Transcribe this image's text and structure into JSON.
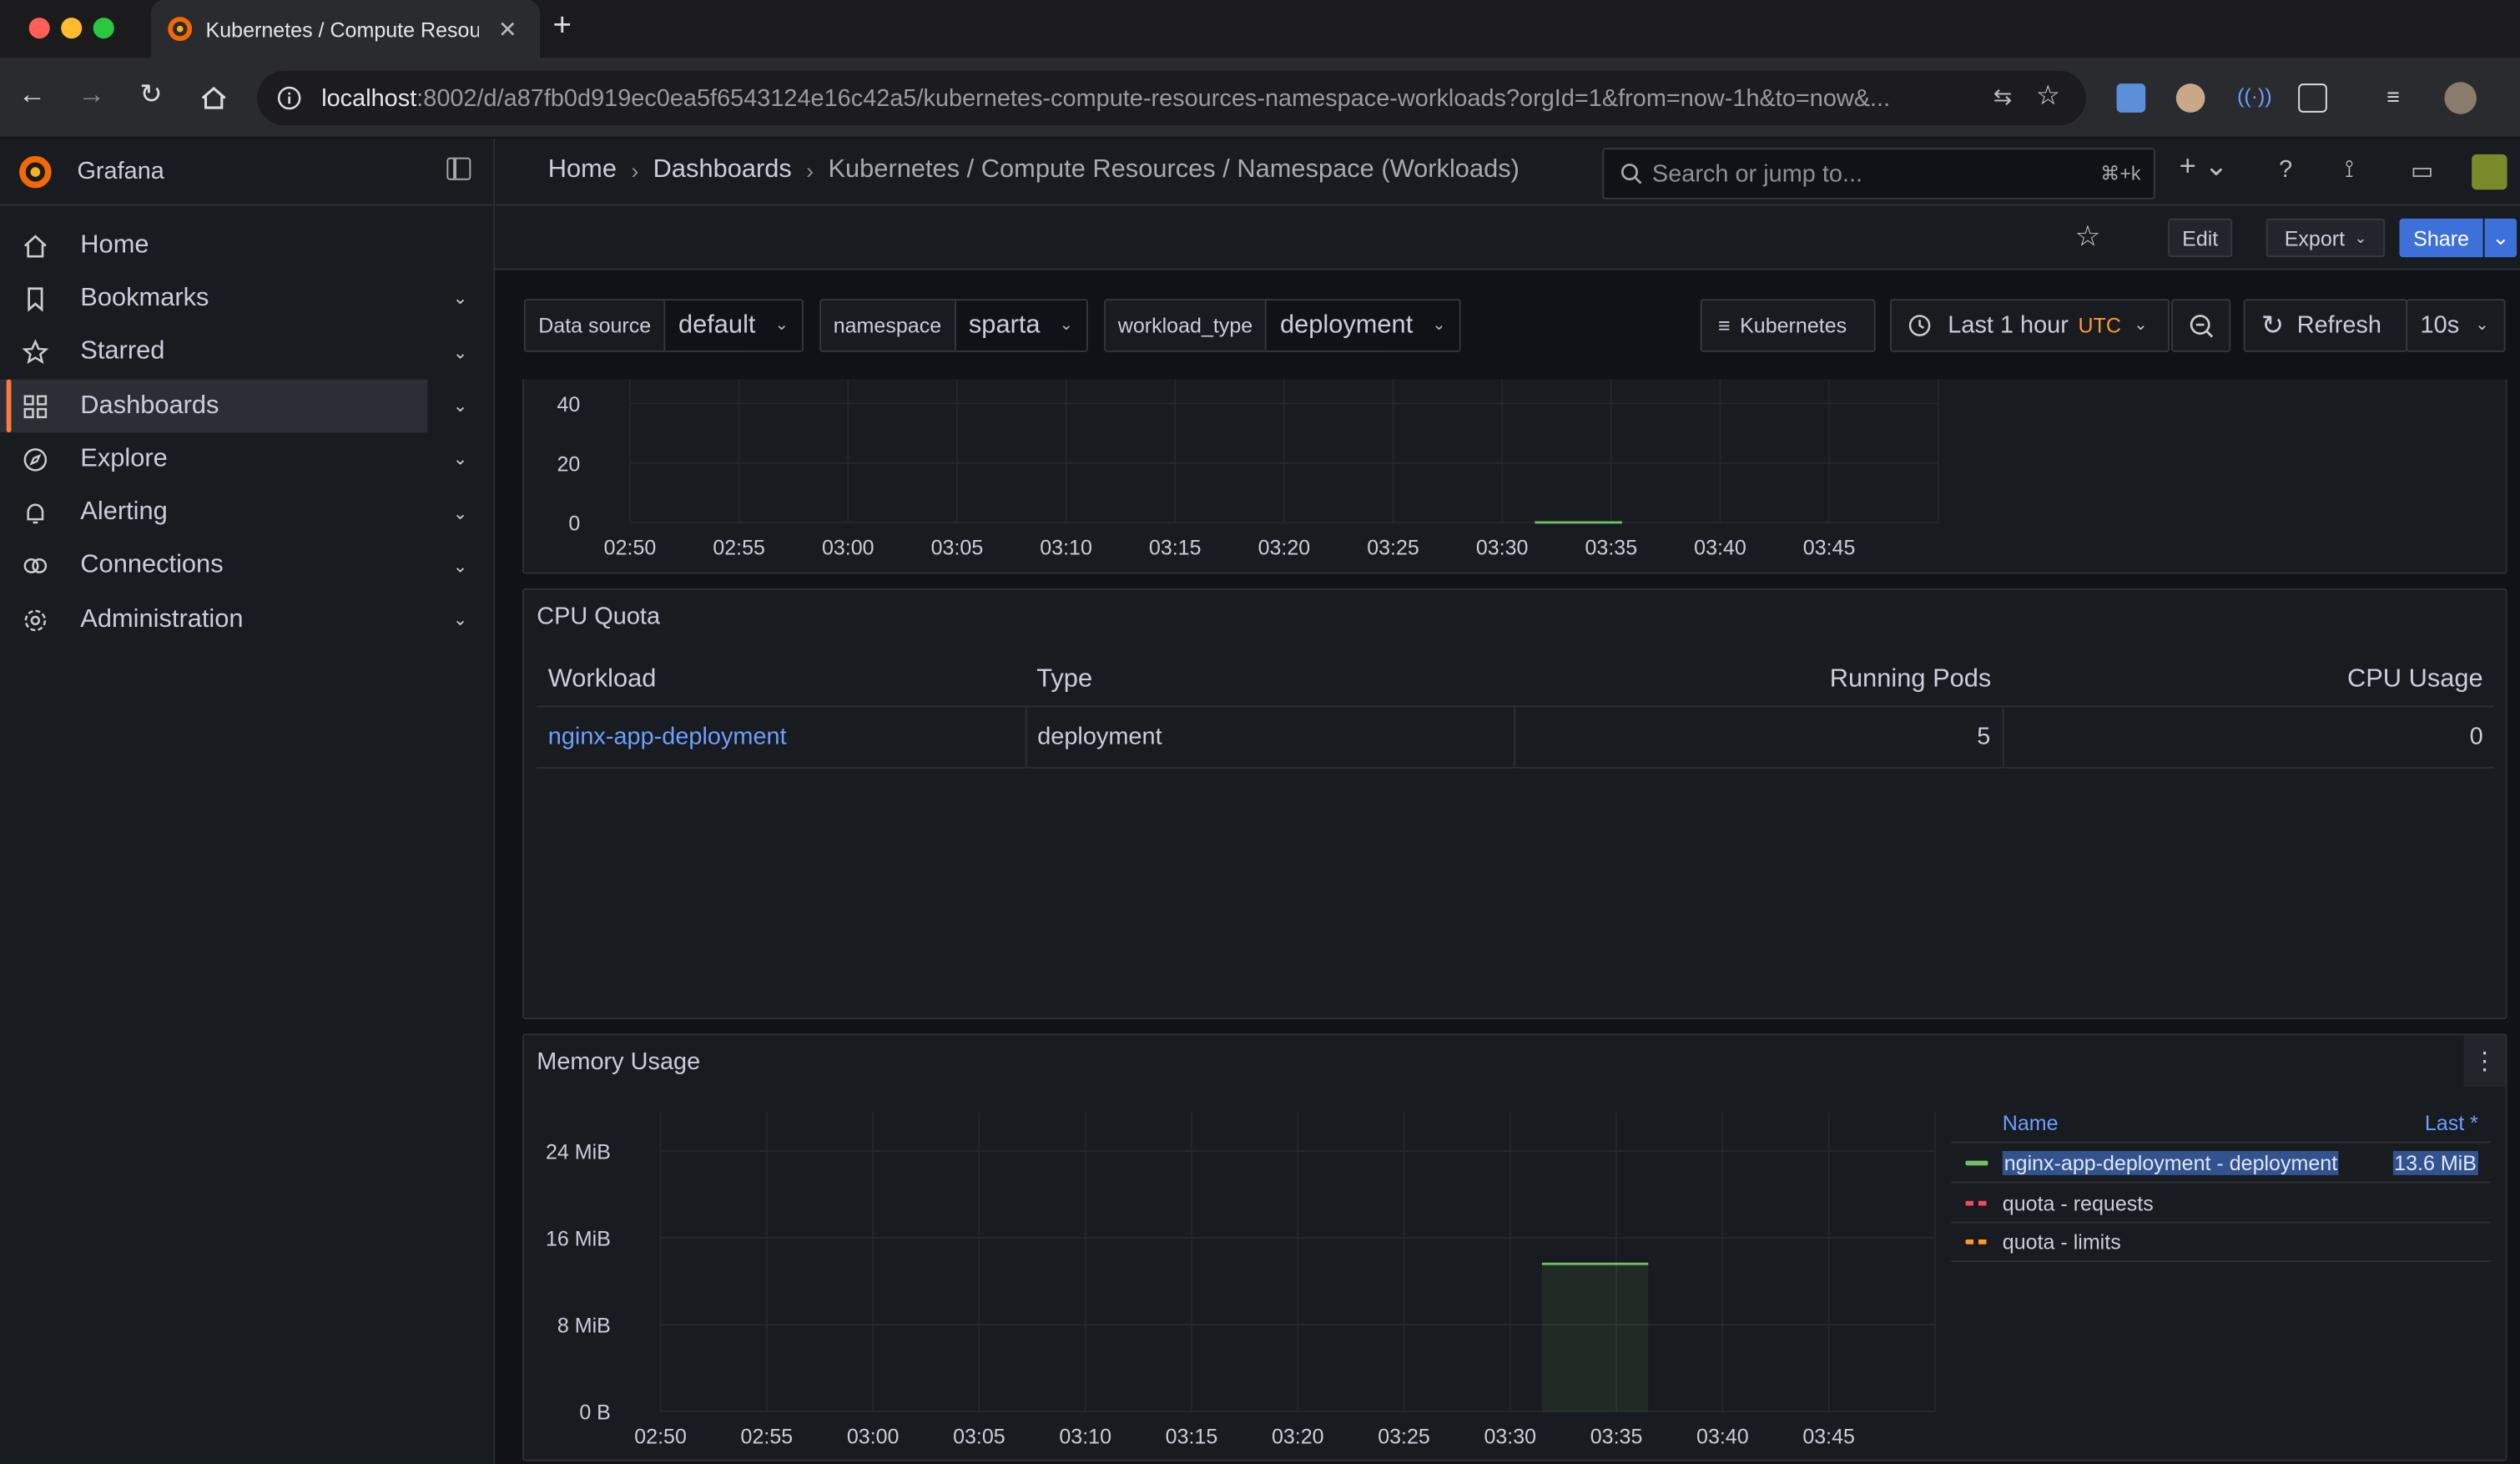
{
  "browser": {
    "tab_title": "Kubernetes / Compute Resou",
    "url_host": "localhost",
    "url_rest": ":8002/d/a87fb0d919ec0ea5f6543124e16c42a5/kubernetes-compute-resources-namespace-workloads?orgId=1&from=now-1h&to=now&...",
    "colors": {
      "close": "#ff5f57",
      "minimize": "#febc2e",
      "zoom": "#28c840"
    }
  },
  "app": {
    "name": "Grafana",
    "accent": "#ff7941",
    "link": "#6e9fff"
  },
  "sidebar": {
    "items": [
      {
        "label": "Home",
        "icon": "home-icon"
      },
      {
        "label": "Bookmarks",
        "icon": "bookmark-icon"
      },
      {
        "label": "Starred",
        "icon": "star-icon"
      },
      {
        "label": "Dashboards",
        "icon": "grid-icon"
      },
      {
        "label": "Explore",
        "icon": "compass-icon"
      },
      {
        "label": "Alerting",
        "icon": "bell-icon"
      },
      {
        "label": "Connections",
        "icon": "connections-icon"
      },
      {
        "label": "Administration",
        "icon": "cog-icon"
      }
    ]
  },
  "header": {
    "breadcrumb": [
      "Home",
      "Dashboards",
      "Kubernetes / Compute Resources / Namespace (Workloads)"
    ],
    "search_placeholder": "Search or jump to...",
    "shortcut": "⌘+k"
  },
  "toolbar": {
    "edit": "Edit",
    "export": "Export",
    "share": "Share"
  },
  "variables": [
    {
      "label": "Data source",
      "value": "default"
    },
    {
      "label": "namespace",
      "value": "sparta"
    },
    {
      "label": "workload_type",
      "value": "deployment"
    }
  ],
  "controls": {
    "dashboards_link": "Kubernetes",
    "time_range": "Last 1 hour",
    "timezone": "UTC",
    "refresh": "Refresh",
    "refresh_interval": "10s"
  },
  "top_panel": {
    "chart_data": {
      "type": "line",
      "x": [
        "02:50",
        "02:55",
        "03:00",
        "03:05",
        "03:10",
        "03:15",
        "03:20",
        "03:25",
        "03:30",
        "03:35",
        "03:40",
        "03:45"
      ],
      "y_ticks": [
        "0",
        "20",
        "40"
      ],
      "series": [
        {
          "color": "#73bf69",
          "points": [
            [
              41.5,
              0
            ],
            [
              45.5,
              0
            ]
          ]
        }
      ]
    }
  },
  "cpu_quota": {
    "title": "CPU Quota",
    "columns": [
      "Workload",
      "Type",
      "Running Pods",
      "CPU Usage"
    ],
    "rows": [
      {
        "workload": "nginx-app-deployment",
        "type": "deployment",
        "running_pods": "5",
        "cpu_usage": "0"
      }
    ]
  },
  "memory_usage": {
    "title": "Memory Usage",
    "legend": {
      "name_header": "Name",
      "last_header": "Last *",
      "items": [
        {
          "name": "nginx-app-deployment - deployment",
          "last": "13.6 MiB",
          "color": "#73bf69"
        },
        {
          "name": "quota - requests",
          "last": "",
          "color": "#f2495c"
        },
        {
          "name": "quota - limits",
          "last": "",
          "color": "#ff9830"
        }
      ]
    },
    "chart_data": {
      "type": "area",
      "x": [
        "02:50",
        "02:55",
        "03:00",
        "03:05",
        "03:10",
        "03:15",
        "03:20",
        "03:25",
        "03:30",
        "03:35",
        "03:40",
        "03:45"
      ],
      "y_ticks": [
        "0 B",
        "8 MiB",
        "16 MiB",
        "24 MiB"
      ],
      "ylim_mib": [
        0,
        24
      ],
      "series": [
        {
          "name": "nginx-app-deployment - deployment",
          "color": "#73bf69",
          "points_min_mib": [
            [
              41.5,
              13.6
            ],
            [
              46.5,
              13.6
            ]
          ]
        }
      ]
    }
  }
}
